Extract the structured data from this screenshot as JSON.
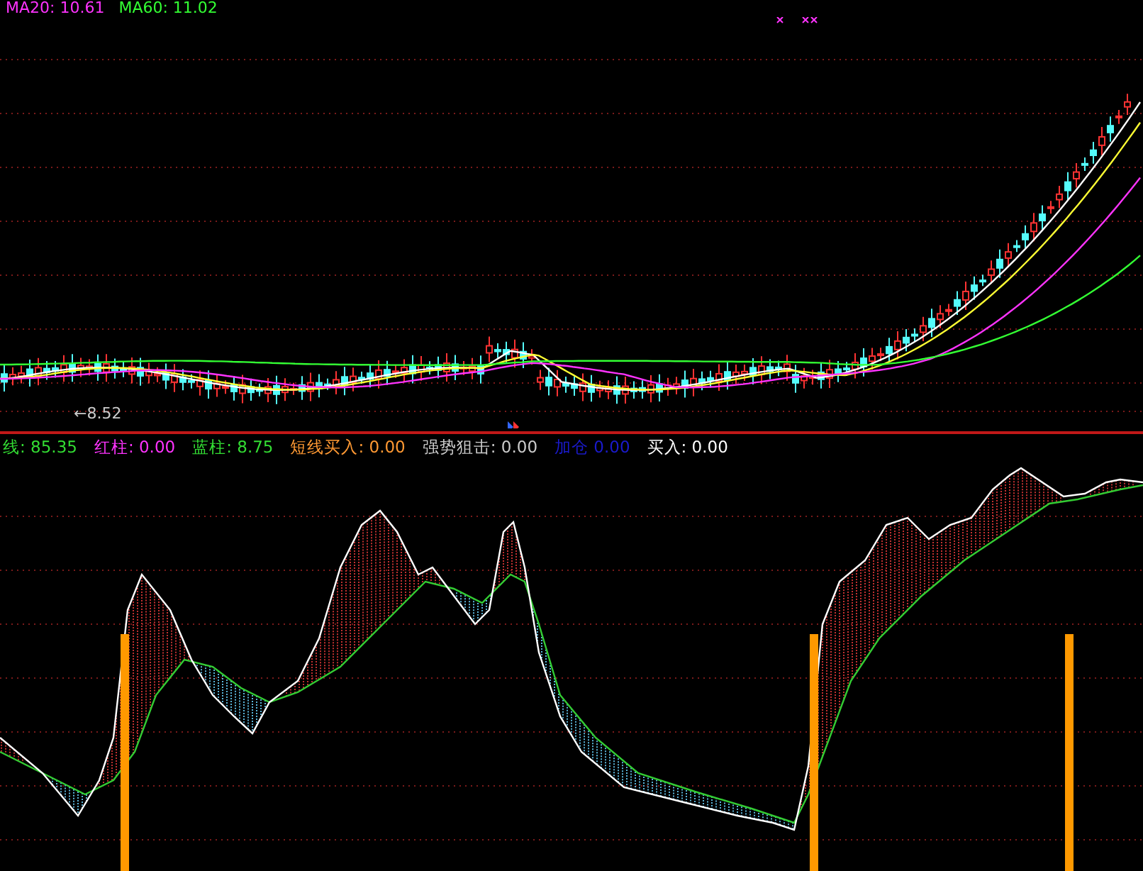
{
  "price_panel": {
    "legend": [
      {
        "text": "MA20: 10.61",
        "color": "#ff33ff"
      },
      {
        "text": "MA60: 11.02",
        "color": "#33ff33"
      }
    ],
    "low_marker": "←8.52"
  },
  "indicator_panel": {
    "legend": [
      {
        "label": "线:",
        "value": "85.35",
        "color": "#33dd33"
      },
      {
        "label": "红柱:",
        "value": "0.00",
        "color": "#ff33ff"
      },
      {
        "label": "蓝柱:",
        "value": "8.75",
        "color": "#33dd33"
      },
      {
        "label": "短线买入:",
        "value": "0.00",
        "color": "#ff9933"
      },
      {
        "label": "强势狙击:",
        "value": "0.00",
        "color": "#cccccc"
      },
      {
        "label": "加仓",
        "value": "0.00",
        "color": "#1a1acc"
      },
      {
        "label": "买入:",
        "value": "0.00",
        "color": "#ffffff"
      }
    ]
  }
}
